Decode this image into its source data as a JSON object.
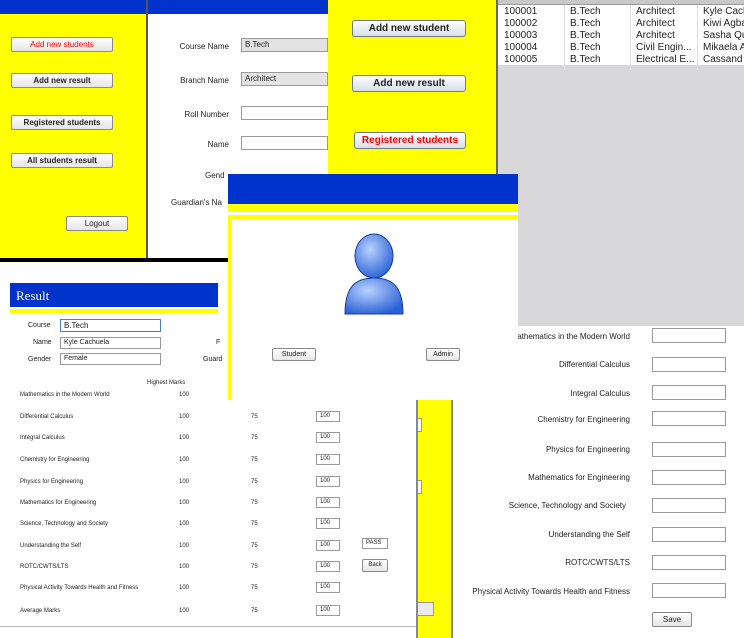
{
  "menu_window": {
    "buttons": [
      "Add new students",
      "Add new result",
      "Registered students",
      "All students result"
    ],
    "logout_label": "Logout"
  },
  "form_window": {
    "fields": [
      {
        "label": "Course Name",
        "value": "B.Tech"
      },
      {
        "label": "Branch Name",
        "value": "Architect"
      },
      {
        "label": "Roll Number",
        "value": ""
      },
      {
        "label": "Name",
        "value": ""
      },
      {
        "label": "Gend",
        "value": ""
      },
      {
        "label": "Guardian's Na",
        "value": ""
      }
    ]
  },
  "side_menu": {
    "add_student": "Add new student",
    "add_result": "Add new result",
    "registered": "Registered students"
  },
  "students_table": {
    "rows": [
      [
        "100001",
        "B.Tech",
        "Architect",
        "Kyle Cach"
      ],
      [
        "100002",
        "B.Tech",
        "Architect",
        "Kiwi Agba"
      ],
      [
        "100003",
        "B.Tech",
        "Architect",
        "Sasha Qu"
      ],
      [
        "100004",
        "B.Tech",
        "Civil Engin...",
        "Mikaela A"
      ],
      [
        "100005",
        "B.Tech",
        "Electrical E...",
        "Cassand"
      ]
    ]
  },
  "login_window": {
    "student_label": "Student",
    "admin_label": "Admin"
  },
  "result_window": {
    "title": "Result",
    "course_label": "Course",
    "course_value": "B.Tech",
    "name_label": "Name",
    "name_value": "Kyle Cachuela",
    "gender_label": "Gender",
    "gender_value": "Female",
    "extra_label_f": "F",
    "extra_label_guard": "Guard",
    "header_marks": "Highest Marks",
    "subjects": [
      {
        "name": "Mathematics in the Modern World",
        "max": "100",
        "pass": "",
        "marks": ""
      },
      {
        "name": "Differential Calculus",
        "max": "100",
        "pass": "75",
        "marks": "100"
      },
      {
        "name": "Integral Calculus",
        "max": "100",
        "pass": "75",
        "marks": "100"
      },
      {
        "name": "Chemistry for Engineering",
        "max": "100",
        "pass": "75",
        "marks": "100"
      },
      {
        "name": "Physics for Engineering",
        "max": "100",
        "pass": "75",
        "marks": "100"
      },
      {
        "name": "Mathematics for Engineering",
        "max": "100",
        "pass": "75",
        "marks": "100"
      },
      {
        "name": "Science, Technology and Society",
        "max": "100",
        "pass": "75",
        "marks": "100"
      },
      {
        "name": "Understanding the Self",
        "max": "100",
        "pass": "75",
        "marks": "100"
      },
      {
        "name": "ROTC/CWTS/LTS",
        "max": "100",
        "pass": "75",
        "marks": "100"
      },
      {
        "name": "Physical Activity Towards Health and Fitness",
        "max": "100",
        "pass": "75",
        "marks": "100"
      },
      {
        "name": "Average Marks",
        "max": "100",
        "pass": "75",
        "marks": "100"
      }
    ],
    "status_value": "PASS",
    "back_label": "Back"
  },
  "right_form": {
    "subjects": [
      "Mathematics in the Modern World",
      "Differential Calculus",
      "Integral Calculus",
      "Chemistry for Engineering",
      "Physics for Engineering",
      "Mathematics for Engineering",
      "Science, Technology and Society",
      "Understanding the Self",
      "ROTC/CWTS/LTS",
      "Physical Activity Towards Health and Fitness"
    ],
    "save_label": "Save"
  },
  "colors": {
    "blue": "#0033cc",
    "yellow": "#ffff00",
    "red_text": "#ff0000",
    "grey_panel": "#d8d8da"
  }
}
